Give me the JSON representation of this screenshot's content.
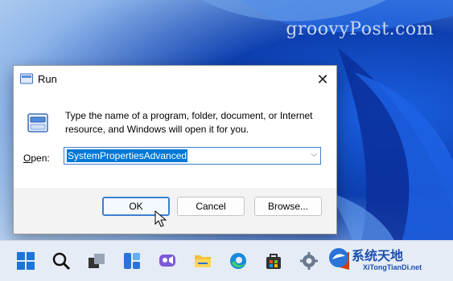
{
  "watermark": "groovyPost.com",
  "dialog": {
    "title": "Run",
    "description": "Type the name of a program, folder, document, or Internet resource, and Windows will open it for you.",
    "open_label_underlined": "O",
    "open_label_rest": "pen:",
    "open_value": "SystemPropertiesAdvanced",
    "ok_label": "OK",
    "cancel_label": "Cancel",
    "browse_label": "Browse..."
  },
  "taskbar": {
    "icons": [
      "windows-start-icon",
      "search-icon",
      "task-view-icon",
      "widgets-icon",
      "chat-icon",
      "file-explorer-icon",
      "edge-icon",
      "store-icon",
      "settings-icon",
      "office-icon"
    ]
  },
  "logo": {
    "text": "系统天地",
    "sub": "XiTongTianDi.net"
  }
}
